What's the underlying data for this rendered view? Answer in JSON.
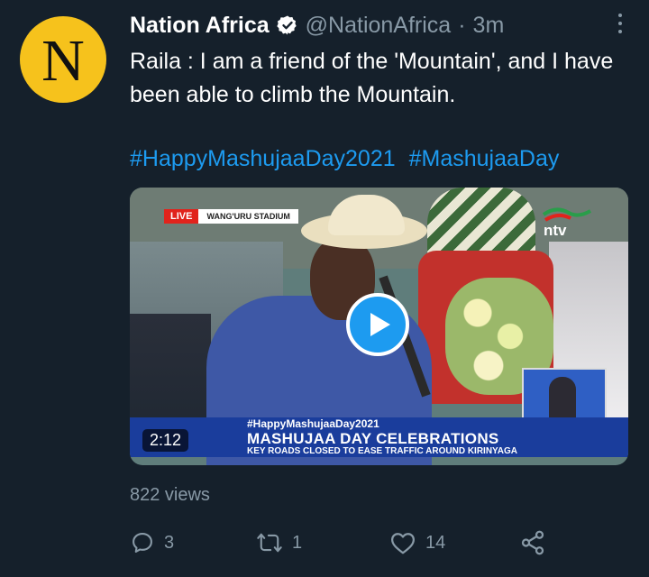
{
  "tweet": {
    "author_initial": "N",
    "display_name": "Nation Africa",
    "handle": "@NationAfrica",
    "separator": "·",
    "timestamp": "3m",
    "text": "Raila : I am a friend of the 'Mountain', and I have been able to climb the Mountain.",
    "hashtags": [
      "#HappyMashujaaDay2021",
      "#MashujaaDay"
    ],
    "views": "822 views"
  },
  "video": {
    "live_label": "LIVE",
    "location_label": "WANG'URU STADIUM",
    "banner_hashtag": "#HappyMashujaaDay2021",
    "banner_headline": "MASHUJAA DAY CELEBRATIONS",
    "banner_subtitle": "KEY ROADS CLOSED TO EASE TRAFFIC AROUND KIRINYAGA",
    "duration": "2:12",
    "channel_logo": "ntv"
  },
  "actions": {
    "reply_count": "3",
    "retweet_count": "1",
    "like_count": "14"
  },
  "icons": {
    "verified": "verified-badge-icon",
    "more": "more-options-icon",
    "play": "play-icon",
    "reply": "reply-icon",
    "retweet": "retweet-icon",
    "like": "like-icon",
    "share": "share-icon"
  },
  "colors": {
    "background": "#15202b",
    "accent": "#1d9bf0",
    "secondary_text": "#8899a6",
    "avatar": "#f6c21c"
  }
}
